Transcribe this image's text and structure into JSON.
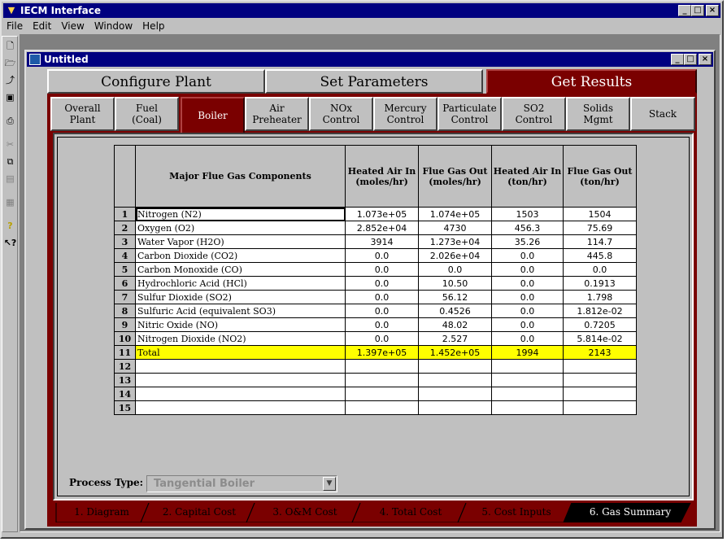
{
  "app": {
    "title": "IECM Interface",
    "menu": [
      "File",
      "Edit",
      "View",
      "Window",
      "Help"
    ]
  },
  "toolbar": {
    "icons": [
      "new-document-icon",
      "open-folder-icon",
      "import-icon",
      "save-disk-icon",
      "print-icon",
      "cut-icon",
      "copy-icon",
      "paste-icon",
      "properties-icon",
      "help-icon",
      "context-help-icon"
    ]
  },
  "child": {
    "title": "Untitled"
  },
  "main_tabs": [
    {
      "label": "Configure Plant"
    },
    {
      "label": "Set Parameters"
    },
    {
      "label": "Get Results",
      "active": true
    }
  ],
  "sub_tabs": [
    {
      "l1": "Overall",
      "l2": "Plant"
    },
    {
      "l1": "Fuel",
      "l2": "(Coal)"
    },
    {
      "l1": "Boiler",
      "l2": "",
      "active": true
    },
    {
      "l1": "Air",
      "l2": "Preheater"
    },
    {
      "l1": "NOx",
      "l2": "Control"
    },
    {
      "l1": "Mercury",
      "l2": "Control"
    },
    {
      "l1": "Particulate",
      "l2": "Control"
    },
    {
      "l1": "SO2",
      "l2": "Control"
    },
    {
      "l1": "Solids",
      "l2": "Mgmt"
    },
    {
      "l1": "Stack",
      "l2": ""
    }
  ],
  "table": {
    "headers": [
      "Major Flue Gas Components",
      "Heated Air In (moles/hr)",
      "Flue Gas Out (moles/hr)",
      "Heated Air In (ton/hr)",
      "Flue Gas Out (ton/hr)"
    ],
    "rows": [
      [
        "1",
        "Nitrogen (N2)",
        "1.073e+05",
        "1.074e+05",
        "1503",
        "1504"
      ],
      [
        "2",
        "Oxygen (O2)",
        "2.852e+04",
        "4730",
        "456.3",
        "75.69"
      ],
      [
        "3",
        "Water Vapor (H2O)",
        "3914",
        "1.273e+04",
        "35.26",
        "114.7"
      ],
      [
        "4",
        "Carbon Dioxide (CO2)",
        "0.0",
        "2.026e+04",
        "0.0",
        "445.8"
      ],
      [
        "5",
        "Carbon Monoxide (CO)",
        "0.0",
        "0.0",
        "0.0",
        "0.0"
      ],
      [
        "6",
        "Hydrochloric Acid (HCl)",
        "0.0",
        "10.50",
        "0.0",
        "0.1913"
      ],
      [
        "7",
        "Sulfur Dioxide (SO2)",
        "0.0",
        "56.12",
        "0.0",
        "1.798"
      ],
      [
        "8",
        "Sulfuric Acid (equivalent SO3)",
        "0.0",
        "0.4526",
        "0.0",
        "1.812e-02"
      ],
      [
        "9",
        "Nitric Oxide (NO)",
        "0.0",
        "48.02",
        "0.0",
        "0.7205"
      ],
      [
        "10",
        "Nitrogen Dioxide (NO2)",
        "0.0",
        "2.527",
        "0.0",
        "5.814e-02"
      ],
      [
        "11",
        "Total",
        "1.397e+05",
        "1.452e+05",
        "1994",
        "2143"
      ],
      [
        "12",
        "",
        "",
        "",
        "",
        ""
      ],
      [
        "13",
        "",
        "",
        "",
        "",
        ""
      ],
      [
        "14",
        "",
        "",
        "",
        "",
        ""
      ],
      [
        "15",
        "",
        "",
        "",
        "",
        ""
      ]
    ],
    "total_row_color": "#ffff00"
  },
  "process_type": {
    "label": "Process Type:",
    "value": "Tangential Boiler"
  },
  "bottom_tabs": [
    {
      "label": "1. Diagram"
    },
    {
      "label": "2. Capital Cost"
    },
    {
      "label": "3. O&M Cost"
    },
    {
      "label": "4. Total Cost"
    },
    {
      "label": "5. Cost Inputs"
    },
    {
      "label": "6. Gas Summary",
      "active": true
    }
  ],
  "colors": {
    "title_bar": "#000080",
    "active_tab": "#7a0000",
    "face": "#c0c0c0"
  }
}
